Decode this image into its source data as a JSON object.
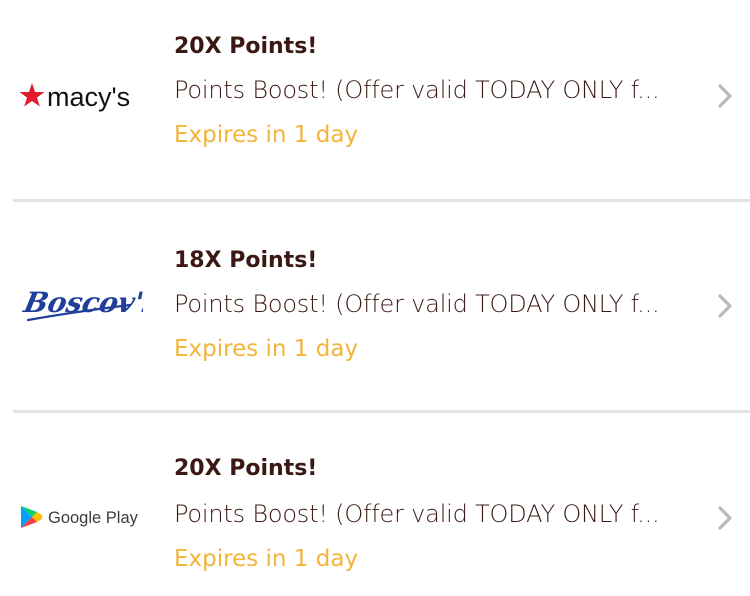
{
  "offers": [
    {
      "title": "20X Points!",
      "description": "Points Boost! (Offer valid TODAY ONLY f...",
      "expiry": "Expires in 1 day",
      "logo_text": "macy's",
      "logo_icon": "macys-star-logo"
    },
    {
      "title": "18X Points!",
      "description": "Points Boost! (Offer valid TODAY ONLY f...",
      "expiry": "Expires in 1 day",
      "logo_text": "Boscov's",
      "logo_icon": "boscovs-script-logo"
    },
    {
      "title": "20X Points!",
      "description": "Points Boost! (Offer valid TODAY ONLY f...",
      "expiry": "Expires in 1 day",
      "logo_text": "Google Play",
      "logo_icon": "google-play-logo"
    }
  ],
  "colors": {
    "title": "#3b1814",
    "expiry": "#f2b43a",
    "chevron": "#b9b9b9",
    "divider": "#e3e3e3",
    "macys_red": "#e21a2c",
    "boscovs_blue": "#1f3f9a"
  },
  "icons": {
    "chevron": "chevron-right-icon"
  }
}
